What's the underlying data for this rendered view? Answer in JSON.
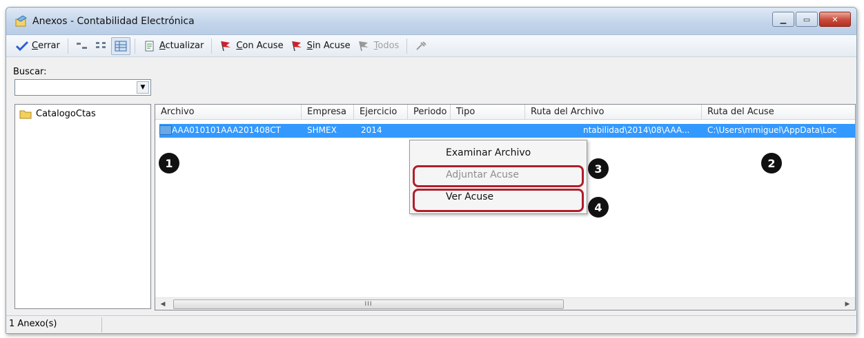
{
  "window": {
    "title": "Anexos - Contabilidad Electrónica",
    "controls": {
      "minimize": "▁",
      "maximize": "▭",
      "close": "✕"
    }
  },
  "toolbar": {
    "close_prefix": "C",
    "close_rest": "errar",
    "refresh_prefix": "A",
    "refresh_rest": "ctualizar",
    "with_ack_prefix": "C",
    "with_ack_rest": "on Acuse",
    "without_ack_prefix": "S",
    "without_ack_rest": "in Acuse",
    "all_prefix": "T",
    "all_rest": "odos"
  },
  "search": {
    "label": "Buscar:",
    "value": ""
  },
  "tree": {
    "items": [
      {
        "label": "CatalogoCtas"
      }
    ]
  },
  "table": {
    "columns": [
      "Archivo",
      "Empresa",
      "Ejercicio",
      "Periodo",
      "Tipo",
      "Ruta del Archivo",
      "Ruta del Acuse"
    ],
    "rows": [
      {
        "archivo": "AAA010101AAA201408CT",
        "empresa": "SHMEX",
        "ejercicio": "2014",
        "periodo": "",
        "tipo": "",
        "ruta_archivo": "ntabilidad\\2014\\08\\AAA...",
        "ruta_acuse": "C:\\Users\\mmiguel\\AppData\\Loc"
      }
    ],
    "scroll_marker": "III"
  },
  "context_menu": {
    "items": [
      {
        "label": "Examinar Archivo",
        "enabled": true
      },
      {
        "label": "Adjuntar Acuse",
        "enabled": false
      },
      {
        "label": "Ver Acuse",
        "enabled": true
      }
    ]
  },
  "callouts": [
    "1",
    "2",
    "3",
    "4"
  ],
  "status": {
    "text": "1 Anexo(s)"
  },
  "colors": {
    "selection": "#3399ff",
    "highlight": "#b01e2b",
    "flag": "#d0202a"
  }
}
